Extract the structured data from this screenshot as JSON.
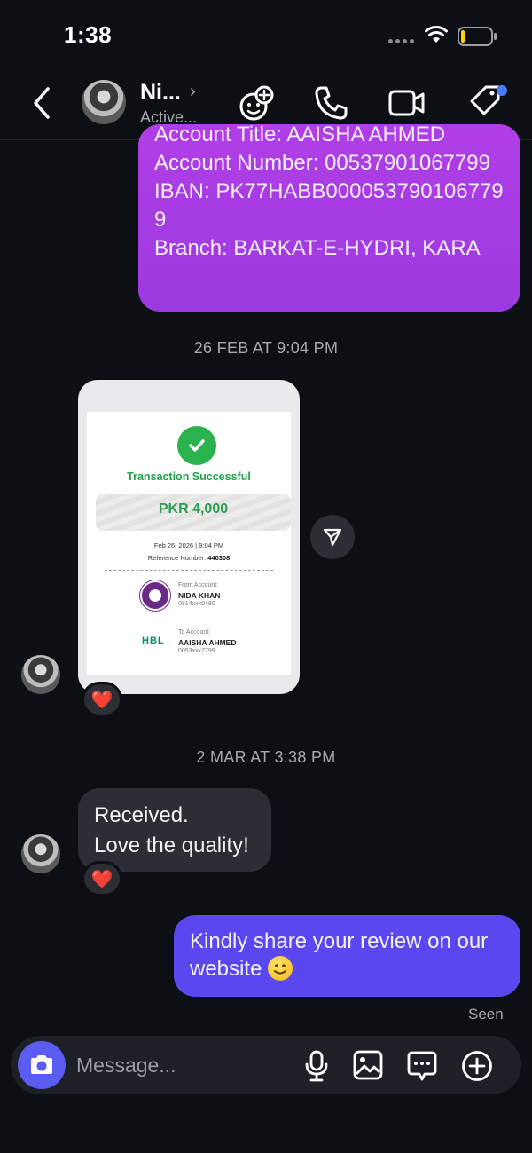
{
  "status_bar": {
    "time": "1:38"
  },
  "header": {
    "contact_name": "Ni...",
    "contact_status": "Active..."
  },
  "messages": {
    "account_details": "Account Title: AAISHA AHMED\nAccount Number: 00537901067799\nIBAN: PK77HABB0000537901067799\nBranch: BARKAT-E-HYDRI, KARA",
    "timestamp_1": "26 FEB AT 9:04 PM",
    "receipt": {
      "title": "Transaction Successful",
      "amount": "PKR 4,000",
      "date": "Feb 26, 2026 | 9:04 PM",
      "reference_label": "Reference Number:",
      "reference_value": "440308",
      "from_label": "From Account:",
      "from_name": "NIDA KHAN",
      "from_account": "0814xxx0480",
      "to_label": "To Account:",
      "to_name": "AAISHA AHMED",
      "to_account": "0053xxx7799",
      "to_bank": "HBL"
    },
    "timestamp_2": "2 MAR AT 3:38 PM",
    "received_message": "Received.\nLove the quality!",
    "reply_message": "Kindly share your review on our website",
    "seen_label": "Seen",
    "reaction_emoji": "❤️"
  },
  "composer": {
    "placeholder": "Message..."
  },
  "colors": {
    "background": "#0c0f14",
    "purple_bubble": "#a83ce4",
    "blue_bubble": "#5a47f0",
    "incoming_bubble": "#2b2e34",
    "camera_button": "#5a5cf2",
    "success_green": "#2bb24c",
    "notification_dot": "#4a7cff"
  }
}
